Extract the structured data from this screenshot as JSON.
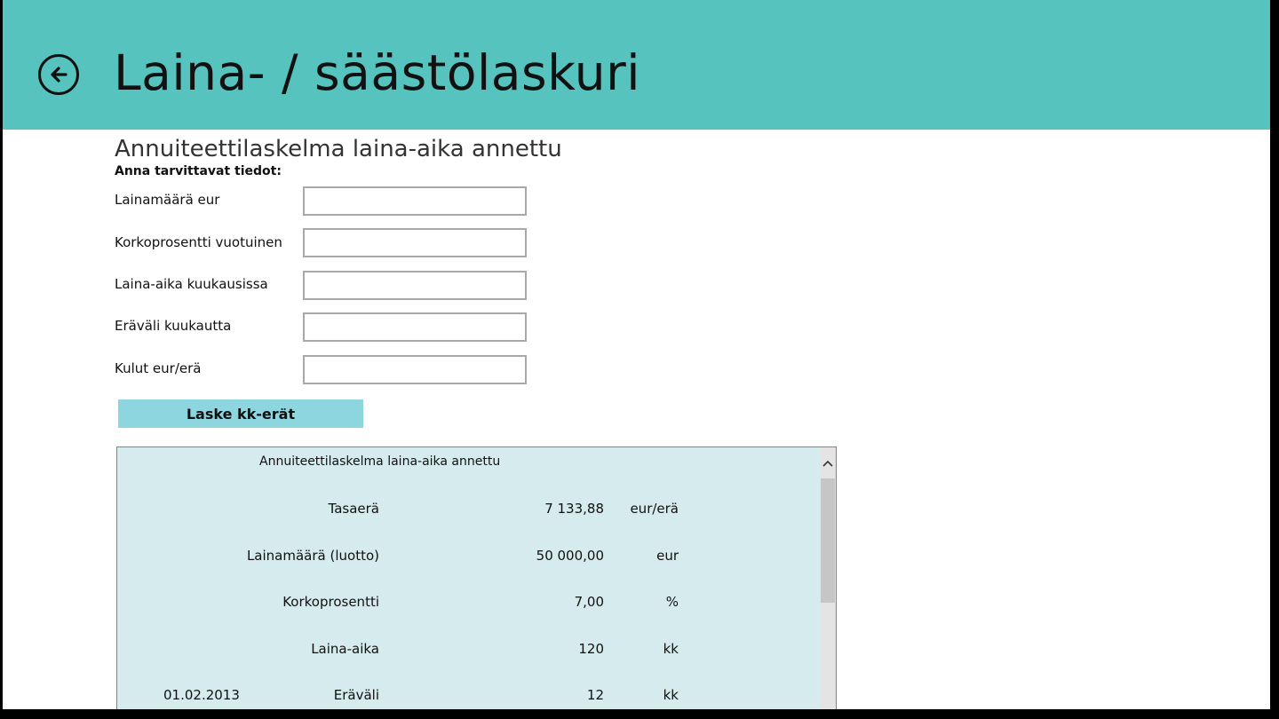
{
  "header": {
    "title": "Laina- / säästölaskuri",
    "back_icon": "arrow-left-circle-icon"
  },
  "form": {
    "section_title": "Annuiteettilaskelma laina-aika annettu",
    "instructions": "Anna tarvittavat tiedot:",
    "fields": [
      {
        "label": "Lainamäärä eur",
        "value": ""
      },
      {
        "label": "Korkoprosentti vuotuinen",
        "value": ""
      },
      {
        "label": "Laina-aika kuukausissa",
        "value": ""
      },
      {
        "label": "Eräväli kuukautta",
        "value": ""
      },
      {
        "label": "Kulut eur/erä",
        "value": ""
      }
    ],
    "calculate_label": "Laske kk-erät"
  },
  "results": {
    "title": "Annuiteettilaskelma laina-aika annettu",
    "rows": [
      {
        "date": "",
        "label": "Tasaerä",
        "value": "7 133,88",
        "unit": "eur/erä"
      },
      {
        "date": "",
        "label": "Lainamäärä (luotto)",
        "value": "50 000,00",
        "unit": "eur"
      },
      {
        "date": "",
        "label": "Korkoprosentti",
        "value": "7,00",
        "unit": "%"
      },
      {
        "date": "",
        "label": "Laina-aika",
        "value": "120",
        "unit": "kk"
      },
      {
        "date": "01.02.2013",
        "label": "Eräväli",
        "value": "12",
        "unit": "kk"
      }
    ]
  },
  "colors": {
    "header_bg": "#56c3bf",
    "button_bg": "#8dd5df",
    "results_bg": "#d5ebed"
  }
}
